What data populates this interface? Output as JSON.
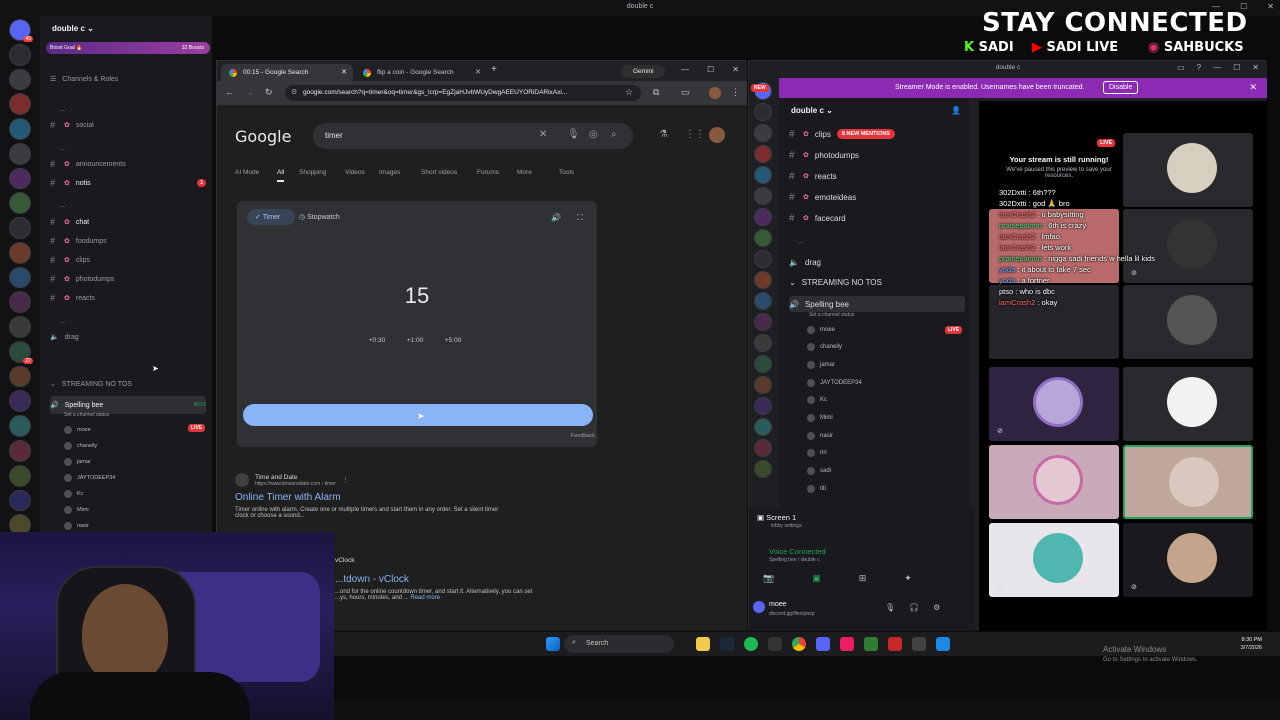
{
  "overlay": {
    "banner_title": "STAY CONNECTED",
    "handle_kick": "SADI",
    "handle_youtube": "SADI LIVE",
    "handle_instagram": "SAHBUCKS"
  },
  "discord_left": {
    "window_title": "double c",
    "server_name": "double c",
    "boost_label": "Boost Goal 🔥",
    "boost_count": "32 Boosts",
    "channels_roles": "Channels & Roles",
    "channels": [
      {
        "name": "social"
      },
      {
        "name": "announcements"
      },
      {
        "name": "notis",
        "badge": "1"
      },
      {
        "name": "chat"
      },
      {
        "name": "foodumps"
      },
      {
        "name": "clips"
      },
      {
        "name": "photodumps"
      },
      {
        "name": "reacts"
      }
    ],
    "drag": "drag",
    "category": "STREAMING NO TOS",
    "voice_channel": "Spelling bee",
    "voice_status": "Set a channel status",
    "voice_time": "49:53",
    "voice_users": [
      "moee",
      "chanelly",
      "jamar",
      "JAYTODEEP34",
      "Kc",
      "Mimi",
      "nasir"
    ],
    "live_label": "LIVE",
    "server_badges": [
      "43",
      "",
      "",
      "",
      "",
      "",
      "",
      "",
      "",
      "",
      "",
      "",
      "",
      "27",
      "",
      "",
      "",
      "",
      "",
      "",
      ""
    ]
  },
  "chrome": {
    "tabs": [
      {
        "label": "00:15 - Google Search",
        "active": true
      },
      {
        "label": "flip a coin - Google Search",
        "active": false
      }
    ],
    "gemini_label": "Gemini",
    "url": "google.com/search?q=timer&oq=timer&gs_lcrp=EgZjaHJvbWUyDwgAEEUYORiDARixAxi...",
    "google_logo": "Google",
    "query": "timer",
    "nav": [
      "AI Mode",
      "All",
      "Shopping",
      "Videos",
      "Images",
      "Short videos",
      "Forums",
      "More",
      "Tools"
    ],
    "timer_tab": "Timer",
    "stopwatch_tab": "Stopwatch",
    "timer_value": "15",
    "add_buttons": [
      "+0:30",
      "+1:00",
      "+5:00"
    ],
    "timer_progress": 1.0,
    "feedback": "Feedback",
    "result1": {
      "site": "Time and Date",
      "url": "https://www.timeanddate.com › timer",
      "title": "Online Timer with Alarm",
      "snippet": "Timer online with alarm. Create one or multiple timers and start them in any order. Set a silent timer",
      "snippet2": "clock or choose a sound..."
    },
    "result2": {
      "site": "vClock",
      "title": "...tdown - vClock",
      "snippet": "...ond for the online countdown timer, and start it. Alternatively, you can set",
      "snippet2": "...ys, hours, minutes, and ...",
      "read_more": "Read more"
    }
  },
  "taskbar": {
    "search_label": "Search",
    "time": "8:30 PM",
    "date": "3/7/2026",
    "activate_title": "Activate Windows",
    "activate_sub": "Go to Settings to activate Windows."
  },
  "discord_right": {
    "window_title": "double c",
    "streamer_mode": "Streamer Mode is enabled. Usernames have been truncated.",
    "disable_label": "Disable",
    "server_name": "double c",
    "channels": [
      {
        "name": "clips",
        "mention": "8 NEW MENTIONS"
      },
      {
        "name": "photodumps"
      },
      {
        "name": "reacts"
      },
      {
        "name": "emoteideas"
      },
      {
        "name": "facecard"
      }
    ],
    "drag": "drag",
    "category": "STREAMING NO TOS",
    "voice_channel": "Spelling bee",
    "voice_status": "Set a channel status",
    "voice_users": [
      "moee",
      "chanelly",
      "jamar",
      "JAYTODEEP34",
      "Kc",
      "Mimi",
      "nasir",
      "riri",
      "sadi",
      "titi"
    ],
    "live_label": "LIVE",
    "new_label": "NEW",
    "screen_label": "Screen 1",
    "screen_sub": "lobby settings",
    "voice_connected": "Voice Connected",
    "voice_connected_sub": "Spelling bee / double c",
    "user_name": "moee",
    "user_sub": "discord.gg/lifestylerp",
    "stream_still_running": "Your stream is still running!",
    "stream_sub": "We've paused this preview to save your resources.",
    "chat": [
      {
        "user": "302Dxtti",
        "msg": "6th???",
        "cls": "n0"
      },
      {
        "user": "302Dxtti",
        "msg": "god 🙏 bro",
        "cls": "n0"
      },
      {
        "user": "iamCrash2",
        "msg": "u babysitting",
        "cls": "n1"
      },
      {
        "user": "praisepainnn",
        "msg": "6th is crazy",
        "cls": "n2"
      },
      {
        "user": "iamCrash2",
        "msg": "lmfao",
        "cls": "n1"
      },
      {
        "user": "iamCrash2",
        "msg": "lets work",
        "cls": "n1"
      },
      {
        "user": "praisepainnn",
        "msg": "nigga sadi friends w hella lil kids",
        "cls": "n2"
      },
      {
        "user": "yoda",
        "msg": "it about to take 7 sec",
        "cls": "n3"
      },
      {
        "user": "yoda",
        "msg": "a fortner",
        "cls": "n3"
      },
      {
        "user": "ptso",
        "msg": "who is dbc",
        "cls": "n0"
      },
      {
        "user": "iamCrash2",
        "msg": "okay",
        "cls": "n1"
      }
    ]
  },
  "colors": {
    "streamer_banner": "#8d2ab4",
    "live_red": "#e3353b",
    "timer_blue": "#8ab4f8",
    "link_blue": "#8ab4f8"
  }
}
